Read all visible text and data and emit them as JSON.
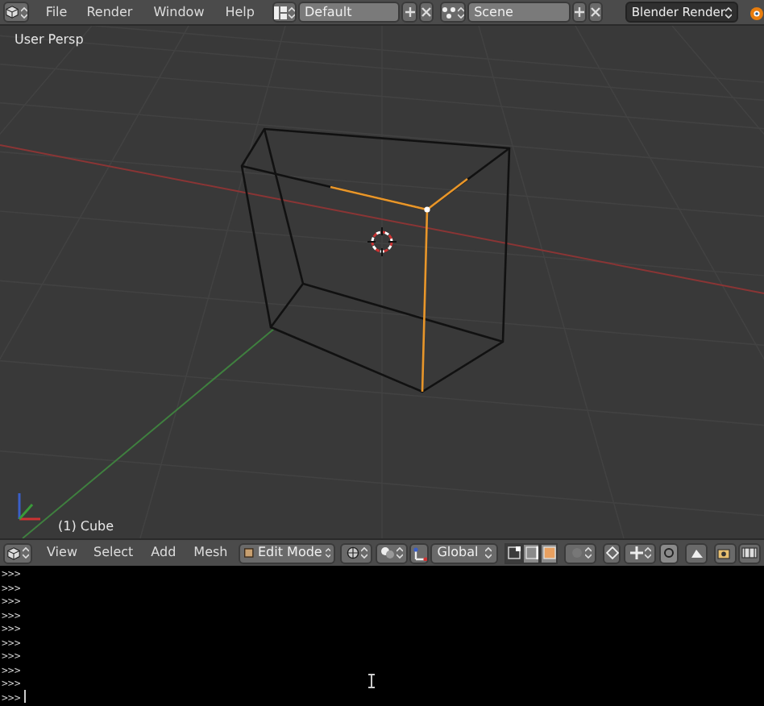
{
  "top_bar": {
    "menus": [
      "File",
      "Render",
      "Window",
      "Help"
    ],
    "layout": "Default",
    "scene": "Scene",
    "engine": "Blender Render"
  },
  "viewport": {
    "view_label": "User Persp",
    "object_label": "(1) Cube"
  },
  "view3d_header": {
    "menus": [
      "View",
      "Select",
      "Add",
      "Mesh"
    ],
    "mode": "Edit Mode",
    "orientation": "Global",
    "select_modes": [
      {
        "kind": "vertex",
        "selected": true
      },
      {
        "kind": "edge",
        "selected": false
      },
      {
        "kind": "face",
        "selected": false
      }
    ]
  },
  "console": {
    "lines": [
      ">>>",
      ">>>",
      ">>>",
      ">>>",
      ">>>",
      ">>>",
      ">>>",
      ">>>",
      ">>>",
      ">>>"
    ]
  }
}
